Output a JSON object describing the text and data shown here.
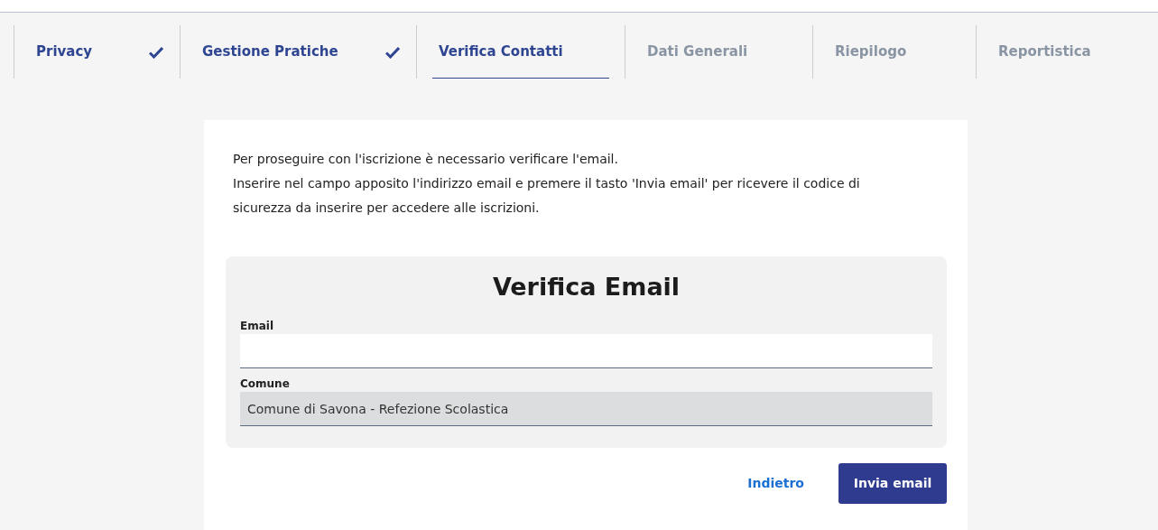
{
  "steps": [
    {
      "label": "Privacy",
      "completed": true,
      "selected": false
    },
    {
      "label": "Gestione Pratiche",
      "completed": true,
      "selected": false
    },
    {
      "label": "Verifica Contatti",
      "completed": false,
      "selected": true
    },
    {
      "label": "Dati Generali",
      "completed": false,
      "selected": false
    },
    {
      "label": "Riepilogo",
      "completed": false,
      "selected": false
    },
    {
      "label": "Reportistica",
      "completed": false,
      "selected": false
    }
  ],
  "intro": [
    "Per proseguire con l'iscrizione è necessario verificare l'email.",
    "Inserire nel campo apposito l'indirizzo email e premere il tasto 'Invia email' per ricevere il codice di sicurezza da inserire per accedere alle iscrizioni."
  ],
  "form": {
    "title": "Verifica Email",
    "fields": [
      {
        "label": "Email",
        "disabled": false
      },
      {
        "label": "Comune",
        "value": "Comune di Savona - Refezione Scolastica",
        "disabled": true
      }
    ]
  },
  "buttons": {
    "back": "Indietro",
    "submit": "Invia email"
  }
}
